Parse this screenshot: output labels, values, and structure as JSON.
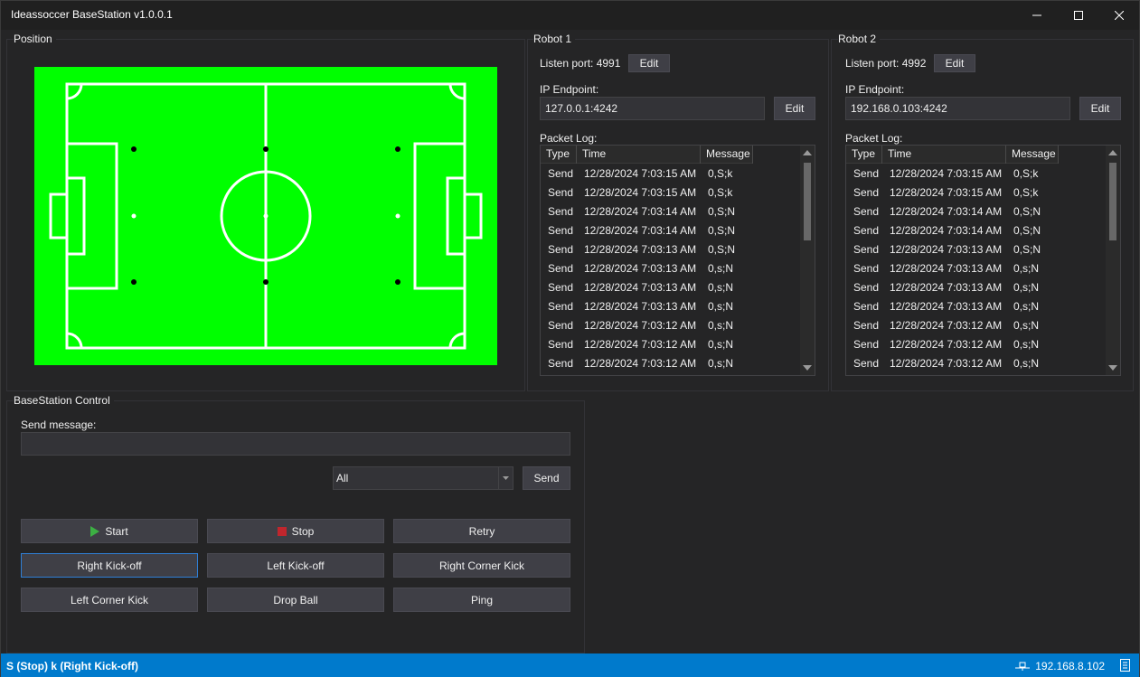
{
  "window": {
    "title": "Ideassoccer BaseStation v1.0.0.1"
  },
  "position": {
    "title": "Position",
    "field_color": "#00ff00"
  },
  "robot1": {
    "title": "Robot 1",
    "listen_port_label": "Listen port: 4991",
    "listen_edit_label": "Edit",
    "ip_endpoint_label": "IP Endpoint:",
    "ip_endpoint_value": "127.0.0.1:4242",
    "ip_edit_label": "Edit",
    "packet_log_label": "Packet Log:",
    "columns": [
      "Type",
      "Time",
      "Message"
    ],
    "rows": [
      {
        "type": "Send",
        "time": "12/28/2024 7:03:15 AM",
        "message": "0,S;k"
      },
      {
        "type": "Send",
        "time": "12/28/2024 7:03:15 AM",
        "message": "0,S;k"
      },
      {
        "type": "Send",
        "time": "12/28/2024 7:03:14 AM",
        "message": "0,S;N"
      },
      {
        "type": "Send",
        "time": "12/28/2024 7:03:14 AM",
        "message": "0,S;N"
      },
      {
        "type": "Send",
        "time": "12/28/2024 7:03:13 AM",
        "message": "0,S;N"
      },
      {
        "type": "Send",
        "time": "12/28/2024 7:03:13 AM",
        "message": "0,s;N"
      },
      {
        "type": "Send",
        "time": "12/28/2024 7:03:13 AM",
        "message": "0,s;N"
      },
      {
        "type": "Send",
        "time": "12/28/2024 7:03:13 AM",
        "message": "0,s;N"
      },
      {
        "type": "Send",
        "time": "12/28/2024 7:03:12 AM",
        "message": "0,s;N"
      },
      {
        "type": "Send",
        "time": "12/28/2024 7:03:12 AM",
        "message": "0,s;N"
      },
      {
        "type": "Send",
        "time": "12/28/2024 7:03:12 AM",
        "message": "0,s;N"
      }
    ]
  },
  "robot2": {
    "title": "Robot 2",
    "listen_port_label": "Listen port: 4992",
    "listen_edit_label": "Edit",
    "ip_endpoint_label": "IP Endpoint:",
    "ip_endpoint_value": "192.168.0.103:4242",
    "ip_edit_label": "Edit",
    "packet_log_label": "Packet Log:",
    "columns": [
      "Type",
      "Time",
      "Message"
    ],
    "rows": [
      {
        "type": "Send",
        "time": "12/28/2024 7:03:15 AM",
        "message": "0,S;k"
      },
      {
        "type": "Send",
        "time": "12/28/2024 7:03:15 AM",
        "message": "0,S;k"
      },
      {
        "type": "Send",
        "time": "12/28/2024 7:03:14 AM",
        "message": "0,S;N"
      },
      {
        "type": "Send",
        "time": "12/28/2024 7:03:14 AM",
        "message": "0,S;N"
      },
      {
        "type": "Send",
        "time": "12/28/2024 7:03:13 AM",
        "message": "0,S;N"
      },
      {
        "type": "Send",
        "time": "12/28/2024 7:03:13 AM",
        "message": "0,s;N"
      },
      {
        "type": "Send",
        "time": "12/28/2024 7:03:13 AM",
        "message": "0,s;N"
      },
      {
        "type": "Send",
        "time": "12/28/2024 7:03:13 AM",
        "message": "0,s;N"
      },
      {
        "type": "Send",
        "time": "12/28/2024 7:03:12 AM",
        "message": "0,s;N"
      },
      {
        "type": "Send",
        "time": "12/28/2024 7:03:12 AM",
        "message": "0,s;N"
      },
      {
        "type": "Send",
        "time": "12/28/2024 7:03:12 AM",
        "message": "0,s;N"
      }
    ]
  },
  "control": {
    "title": "BaseStation Control",
    "send_message_label": "Send message:",
    "send_message_value": "",
    "target_selected": "All",
    "send_label": "Send",
    "buttons": {
      "start": "Start",
      "stop": "Stop",
      "retry": "Retry",
      "right_kickoff": "Right Kick-off",
      "left_kickoff": "Left Kick-off",
      "right_corner": "Right Corner Kick",
      "left_corner": "Left Corner Kick",
      "drop_ball": "Drop Ball",
      "ping": "Ping"
    },
    "start_icon_color": "#3cb043",
    "stop_icon_color": "#c0262d"
  },
  "status": {
    "left_text": "S (Stop)  k (Right Kick-off)",
    "ip": "192.168.8.102",
    "color": "#007acc"
  }
}
